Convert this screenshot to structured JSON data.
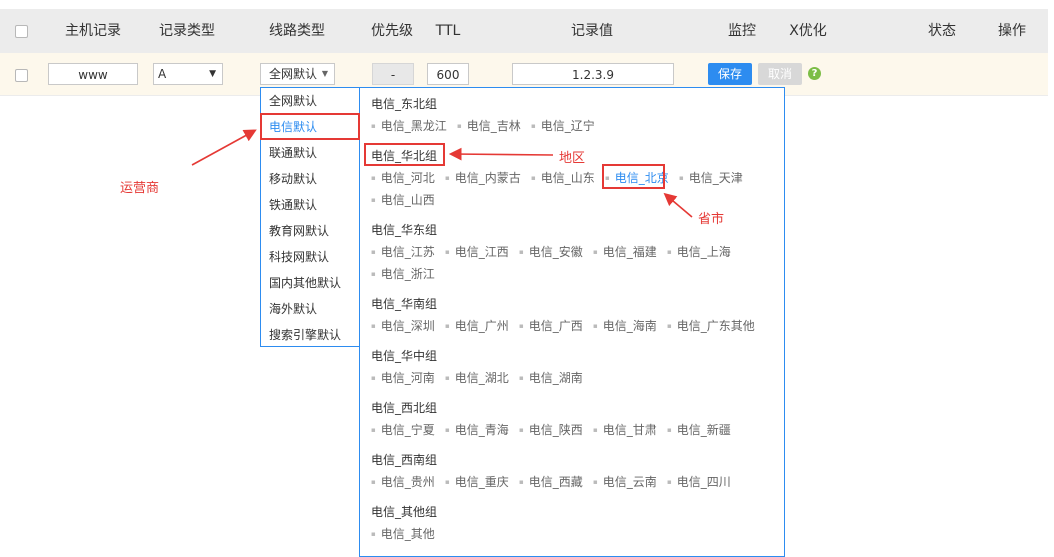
{
  "header": {
    "host_record": "主机记录",
    "record_type": "记录类型",
    "line_type": "线路类型",
    "priority": "优先级",
    "ttl": "TTL",
    "record_value": "记录值",
    "monitor": "监控",
    "x_optimize": "X优化",
    "status": "状态",
    "action": "操作"
  },
  "edit_row": {
    "host_value": "www",
    "type_value": "A",
    "line_value": "全网默认",
    "priority_value": "-",
    "ttl_value": "600",
    "record_value": "1.2.3.9",
    "save_label": "保存",
    "cancel_label": "取消",
    "help_symbol": "?"
  },
  "carrier_menu": {
    "items": [
      "全网默认",
      "电信默认",
      "联通默认",
      "移动默认",
      "铁通默认",
      "教育网默认",
      "科技网默认",
      "国内其他默认",
      "海外默认",
      "搜索引擎默认"
    ],
    "selected": "电信默认"
  },
  "regions": [
    {
      "title": "电信_东北组",
      "provinces": [
        "电信_黑龙江",
        "电信_吉林",
        "电信_辽宁"
      ]
    },
    {
      "title": "电信_华北组",
      "provinces": [
        "电信_河北",
        "电信_内蒙古",
        "电信_山东",
        "电信_北京",
        "电信_天津",
        "电信_山西"
      ]
    },
    {
      "title": "电信_华东组",
      "provinces": [
        "电信_江苏",
        "电信_江西",
        "电信_安徽",
        "电信_福建",
        "电信_上海",
        "电信_浙江"
      ]
    },
    {
      "title": "电信_华南组",
      "provinces": [
        "电信_深圳",
        "电信_广州",
        "电信_广西",
        "电信_海南",
        "电信_广东其他"
      ]
    },
    {
      "title": "电信_华中组",
      "provinces": [
        "电信_河南",
        "电信_湖北",
        "电信_湖南"
      ]
    },
    {
      "title": "电信_西北组",
      "provinces": [
        "电信_宁夏",
        "电信_青海",
        "电信_陕西",
        "电信_甘肃",
        "电信_新疆"
      ]
    },
    {
      "title": "电信_西南组",
      "provinces": [
        "电信_贵州",
        "电信_重庆",
        "电信_西藏",
        "电信_云南",
        "电信_四川"
      ]
    },
    {
      "title": "电信_其他组",
      "provinces": [
        "电信_其他"
      ]
    }
  ],
  "active_province": "电信_北京",
  "annotations": {
    "carrier": "运营商",
    "region": "地区",
    "province": "省市",
    "color": "#e53935"
  },
  "colors": {
    "accent": "#2d8cf0",
    "header_bg": "#ececec",
    "row_bg": "#fdf8ec"
  }
}
